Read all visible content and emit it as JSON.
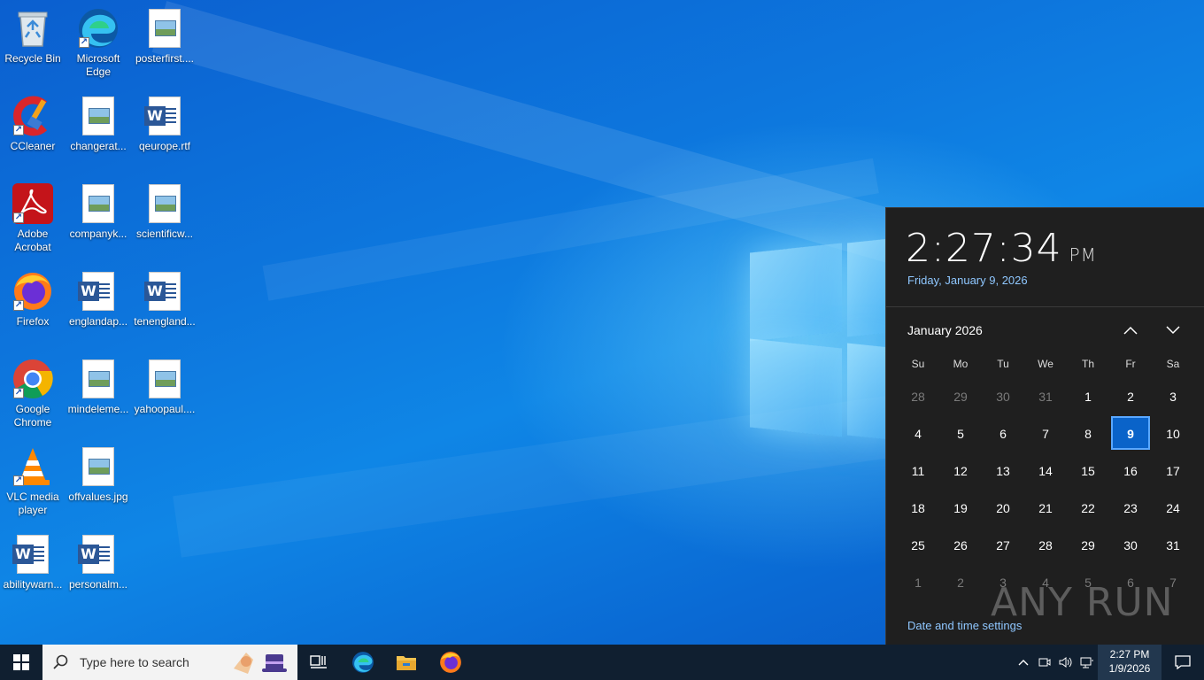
{
  "desktop": {
    "icons": [
      {
        "label": "Recycle Bin"
      },
      {
        "label": "Microsoft Edge"
      },
      {
        "label": "posterfirst...."
      },
      {
        "label": "CCleaner"
      },
      {
        "label": "changerat..."
      },
      {
        "label": "qeurope.rtf"
      },
      {
        "label": "Adobe Acrobat"
      },
      {
        "label": "companyk..."
      },
      {
        "label": "scientificw..."
      },
      {
        "label": "Firefox"
      },
      {
        "label": "englandap..."
      },
      {
        "label": "tenengland..."
      },
      {
        "label": "Google Chrome"
      },
      {
        "label": "mindeleme..."
      },
      {
        "label": "yahoopaul...."
      },
      {
        "label": "VLC media player"
      },
      {
        "label": "offvalues.jpg"
      },
      {
        "label": "abilitywarn..."
      },
      {
        "label": "personalm..."
      }
    ]
  },
  "flyout": {
    "time": "2:27:34",
    "ampm": "PM",
    "long_date": "Friday, January 9, 2026",
    "month_title": "January 2026",
    "weekdays": [
      "Su",
      "Mo",
      "Tu",
      "We",
      "Th",
      "Fr",
      "Sa"
    ],
    "weeks": [
      [
        "28",
        "29",
        "30",
        "31",
        "1",
        "2",
        "3"
      ],
      [
        "4",
        "5",
        "6",
        "7",
        "8",
        "9",
        "10"
      ],
      [
        "11",
        "12",
        "13",
        "14",
        "15",
        "16",
        "17"
      ],
      [
        "18",
        "19",
        "20",
        "21",
        "22",
        "23",
        "24"
      ],
      [
        "25",
        "26",
        "27",
        "28",
        "29",
        "30",
        "31"
      ],
      [
        "1",
        "2",
        "3",
        "4",
        "5",
        "6",
        "7"
      ]
    ],
    "settings_link": "Date and time settings",
    "watermark": "ANY RUN"
  },
  "taskbar": {
    "search_placeholder": "Type here to search",
    "clock_time": "2:27 PM",
    "clock_date": "1/9/2026"
  },
  "colors": {
    "accent": "#0a63c9",
    "link": "#8fc7ff",
    "flyout_bg": "#1f1f1f",
    "taskbar_bg": "#101f30"
  },
  "icons": [
    "windows-start-icon",
    "search-icon",
    "task-view-icon",
    "edge-icon",
    "file-explorer-icon",
    "firefox-icon",
    "chevron-up-icon",
    "chevron-down-icon",
    "network-icon",
    "volume-icon",
    "notification-icon"
  ]
}
